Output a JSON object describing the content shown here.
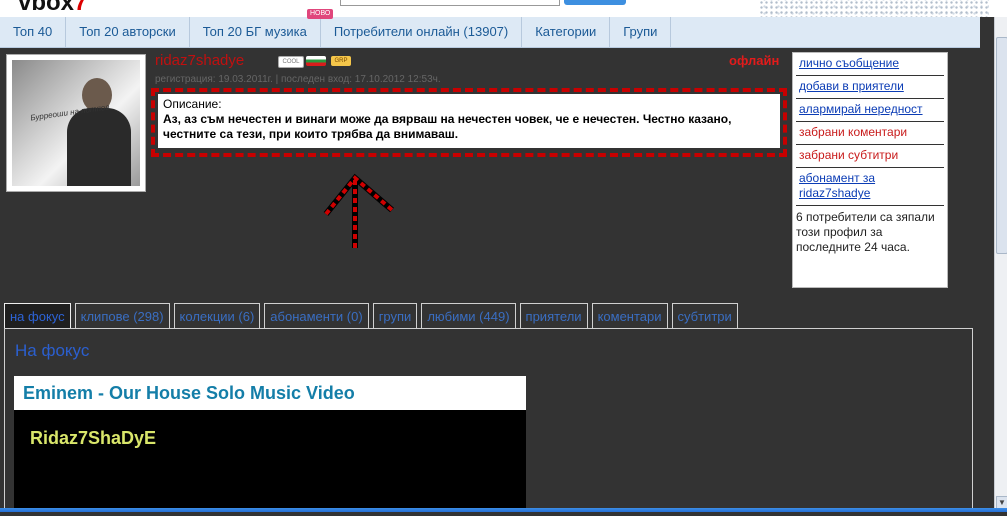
{
  "app": {
    "logo": "vbox",
    "logo_suffix": "7",
    "top_cut_text": "",
    "new_badge": "НОВО"
  },
  "nav": {
    "items": [
      {
        "label": "Топ 40"
      },
      {
        "label": "Топ 20 авторски"
      },
      {
        "label": "Топ 20 БГ музика"
      },
      {
        "label": "Потребители онлайн (13907)"
      },
      {
        "label": "Категории"
      },
      {
        "label": "Групи"
      }
    ]
  },
  "profile": {
    "username": "ridaz7shadye",
    "badges": {
      "cool": "COOL",
      "group": "GRP"
    },
    "status": "офлайн",
    "meta": "регистрация: 19.03.2011г. | последен вход: 17.10.2012 12:53ч.",
    "description_label": "Описание:",
    "description": "Аз, аз съм нечестен и винаги може да вярваш на нечестен човек, че е нечестен. Честно казано, честните са тези, при които трябва да внимаваш.",
    "avatar_text": "Бурреоши на потпов"
  },
  "sidebar": {
    "links": [
      {
        "label": "лично съобщение"
      },
      {
        "label": "добави в приятели"
      },
      {
        "label": "алармирай нередност"
      },
      {
        "label": "забрани коментари"
      },
      {
        "label": "забрани субтитри"
      },
      {
        "label": "абонамент за ridaz7shadye"
      }
    ],
    "stats": "6 потребители са зяпали този профил за последните 24 часа."
  },
  "tabs": [
    {
      "label": "на фокус"
    },
    {
      "label": "клипове (298)"
    },
    {
      "label": "колекции (6)"
    },
    {
      "label": "абонаменти (0)"
    },
    {
      "label": "групи"
    },
    {
      "label": "любими (449)"
    },
    {
      "label": "приятели"
    },
    {
      "label": "коментари"
    },
    {
      "label": "субтитри"
    }
  ],
  "content": {
    "focus_title": "На фокус",
    "video_title": "Eminem - Our House Solo Music Video",
    "video_overlay": "Ridaz7ShaDyE"
  },
  "colors": {
    "accent": "#2b5fcf",
    "warning": "#c80000",
    "nav_bg": "#dde9f5"
  }
}
